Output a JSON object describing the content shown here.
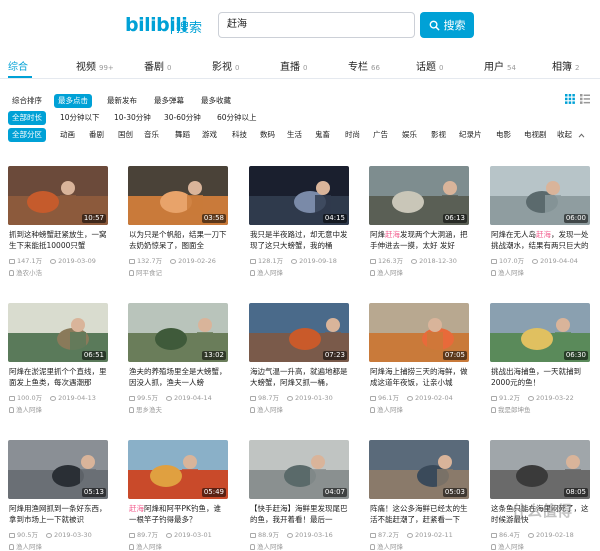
{
  "header": {
    "logo": "bilibili",
    "logo_sub": "搜索",
    "search_value": "赶海",
    "search_button": "搜索"
  },
  "tabs": [
    {
      "label": "综合",
      "count": ""
    },
    {
      "label": "视频",
      "count": "99+"
    },
    {
      "label": "番剧",
      "count": "0"
    },
    {
      "label": "影视",
      "count": "0"
    },
    {
      "label": "直播",
      "count": "0"
    },
    {
      "label": "专栏",
      "count": "66"
    },
    {
      "label": "话题",
      "count": "0"
    },
    {
      "label": "用户",
      "count": "54"
    },
    {
      "label": "相簿",
      "count": "2"
    }
  ],
  "sort": [
    "综合排序",
    "最多点击",
    "最新发布",
    "最多弹幕",
    "最多收藏"
  ],
  "duration": [
    "全部时长",
    "10分钟以下",
    "10-30分钟",
    "30-60分钟",
    "60分钟以上"
  ],
  "zones": [
    "全部分区",
    "动画",
    "番剧",
    "国创",
    "音乐",
    "舞蹈",
    "游戏",
    "科技",
    "数码",
    "生活",
    "鬼畜",
    "时尚",
    "广告",
    "娱乐",
    "影视",
    "纪录片",
    "电影",
    "电视剧",
    "收起"
  ],
  "colors": {
    "accent": "#00a1d6",
    "highlight": "#f25d8e"
  },
  "videos": [
    {
      "title_pre": "抓到这种螃蟹赶紧放生，一窝生下来能抵10000只蟹",
      "title_hl": "",
      "duration": "10:57",
      "views": "147.1万",
      "date": "2019-03-09",
      "uploader": "渔农小浩"
    },
    {
      "title_pre": "以为只是个帆船，结果一刀下去奶奶惊呆了，图面全",
      "title_hl": "",
      "duration": "03:58",
      "views": "132.7万",
      "date": "2019-02-26",
      "uploader": "阿平食记"
    },
    {
      "title_pre": "我只是半夜路过，却无意中发现了这只大螃蟹，我的桶",
      "title_hl": "",
      "duration": "04:15",
      "views": "128.1万",
      "date": "2019-09-18",
      "uploader": "渔人阿烽"
    },
    {
      "title_pre": "阿烽",
      "title_hl": "赶海",
      "title_post": "发现两个大洞涵，把手伸进去一摸，太好 发好",
      "duration": "06:13",
      "views": "126.3万",
      "date": "2018-12-30",
      "uploader": "渔人阿烽"
    },
    {
      "title_pre": "阿烽在无人岛",
      "title_hl": "赶海",
      "title_post": "，发现一处挑战潮水，结果有两只巨大的",
      "duration": "06:00",
      "views": "107.0万",
      "date": "2019-04-04",
      "uploader": "渔人阿烽"
    },
    {
      "title_pre": "阿烽在淤泥里抓个个直线，里面发上鱼类，每次遇潮那",
      "title_hl": "",
      "duration": "06:51",
      "views": "100.0万",
      "date": "2019-04-13",
      "uploader": "渔人阿烽"
    },
    {
      "title_pre": "渔夫的养殖场里全是大螃蟹，因没人抓，渔夫一人螃",
      "title_hl": "",
      "duration": "13:02",
      "views": "99.5万",
      "date": "2019-04-14",
      "uploader": "思乡渔夫"
    },
    {
      "title_pre": "海边气温一升高，就遍地都是大螃蟹，阿烽又抓一桶，",
      "title_hl": "",
      "duration": "07:23",
      "views": "98.7万",
      "date": "2019-01-30",
      "uploader": "渔人阿烽"
    },
    {
      "title_pre": "阿烽海上捕捞三天的海鲜，做成这道年夜饭，让亲小城",
      "title_hl": "",
      "duration": "07:05",
      "views": "96.1万",
      "date": "2019-02-04",
      "uploader": "渔人阿烽"
    },
    {
      "title_pre": "挑战出海捕鱼，一天就捕到2000元的鱼！",
      "title_hl": "",
      "duration": "06:30",
      "views": "91.2万",
      "date": "2019-03-22",
      "uploader": "我是郎坤鱼"
    },
    {
      "title_pre": "阿烽用渔网抓到一条好东西，拿到市场上一下就被识",
      "title_hl": "",
      "duration": "05:13",
      "views": "90.5万",
      "date": "2019-03-30",
      "uploader": "渔人阿烽"
    },
    {
      "title_pre": "",
      "title_hl": "赶海",
      "title_post": "阿烽和阿平PK钓鱼，谁一根竿子钓得最多？",
      "duration": "05:49",
      "views": "89.7万",
      "date": "2019-03-01",
      "uploader": "渔人阿烽"
    },
    {
      "title_pre": "【快手赶海】海鲜里发现尾巴的鱼，我开着看！最后一",
      "title_hl": "",
      "duration": "04:07",
      "views": "88.9万",
      "date": "2019-03-16",
      "uploader": "渔人阿烽"
    },
    {
      "title_pre": "阵痛！这公多海鲜已经太的生活不能赶潮了，赶紧看一下",
      "title_hl": "",
      "duration": "05:03",
      "views": "87.2万",
      "date": "2019-02-11",
      "uploader": "渔人阿烽"
    },
    {
      "title_pre": "这条鱼只能在海里闷死了，这时候游最快",
      "title_hl": "",
      "duration": "08:05",
      "views": "86.4万",
      "date": "2019-02-18",
      "uploader": "渔人阿烽"
    }
  ],
  "watermark": "什么值得"
}
